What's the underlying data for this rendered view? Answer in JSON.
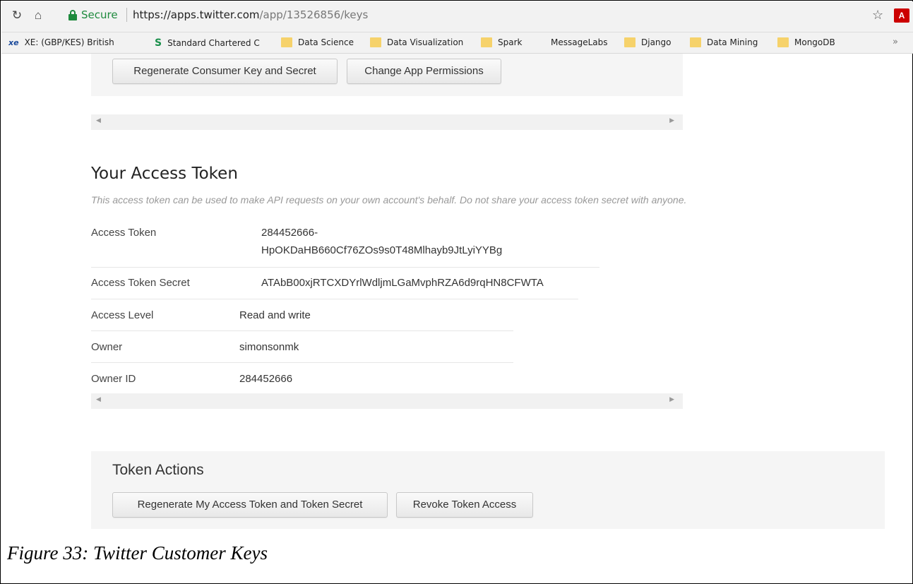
{
  "browser": {
    "secure_label": "Secure",
    "url_host": "https://apps.twitter.com",
    "url_path": "/app/13526856/keys",
    "bookmarks": [
      {
        "icon": "xe-icon",
        "label": "XE: (GBP/KES) British"
      },
      {
        "icon": "standard-chartered-icon",
        "label": "Standard Chartered C"
      },
      {
        "icon": "folder-icon",
        "label": "Data Science"
      },
      {
        "icon": "folder-icon",
        "label": "Data Visualization"
      },
      {
        "icon": "folder-icon",
        "label": "Spark"
      },
      {
        "icon": "none",
        "label": "MessageLabs"
      },
      {
        "icon": "folder-icon",
        "label": "Django"
      },
      {
        "icon": "folder-icon",
        "label": "Data Mining"
      },
      {
        "icon": "folder-icon",
        "label": "MongoDB"
      }
    ],
    "more_label": "»"
  },
  "consumer_actions": {
    "regenerate_label": "Regenerate Consumer Key and Secret",
    "permissions_label": "Change App Permissions"
  },
  "access_token": {
    "title": "Your Access Token",
    "description": "This access token can be used to make API requests on your own account's behalf. Do not share your access token secret with anyone.",
    "rows": [
      {
        "label": "Access Token",
        "value_line1": "284452666-",
        "value_line2": "HpOKDaHB660Cf76ZOs9s0T48Mlhayb9JtLyiYYBg"
      },
      {
        "label": "Access Token Secret",
        "value": "ATAbB00xjRTCXDYrlWdljmLGaMvphRZA6d9rqHN8CFWTA"
      },
      {
        "label": "Access Level",
        "value": "Read and write"
      },
      {
        "label": "Owner",
        "value": "simonsonmk"
      },
      {
        "label": "Owner ID",
        "value": "284452666"
      }
    ]
  },
  "token_actions": {
    "title": "Token Actions",
    "regenerate_label": "Regenerate My Access Token and Token Secret",
    "revoke_label": "Revoke Token Access"
  },
  "caption": "Figure 33: Twitter Customer Keys",
  "colors": {
    "secure_green": "#1e8a3d",
    "panel_bg": "#f5f5f5"
  }
}
